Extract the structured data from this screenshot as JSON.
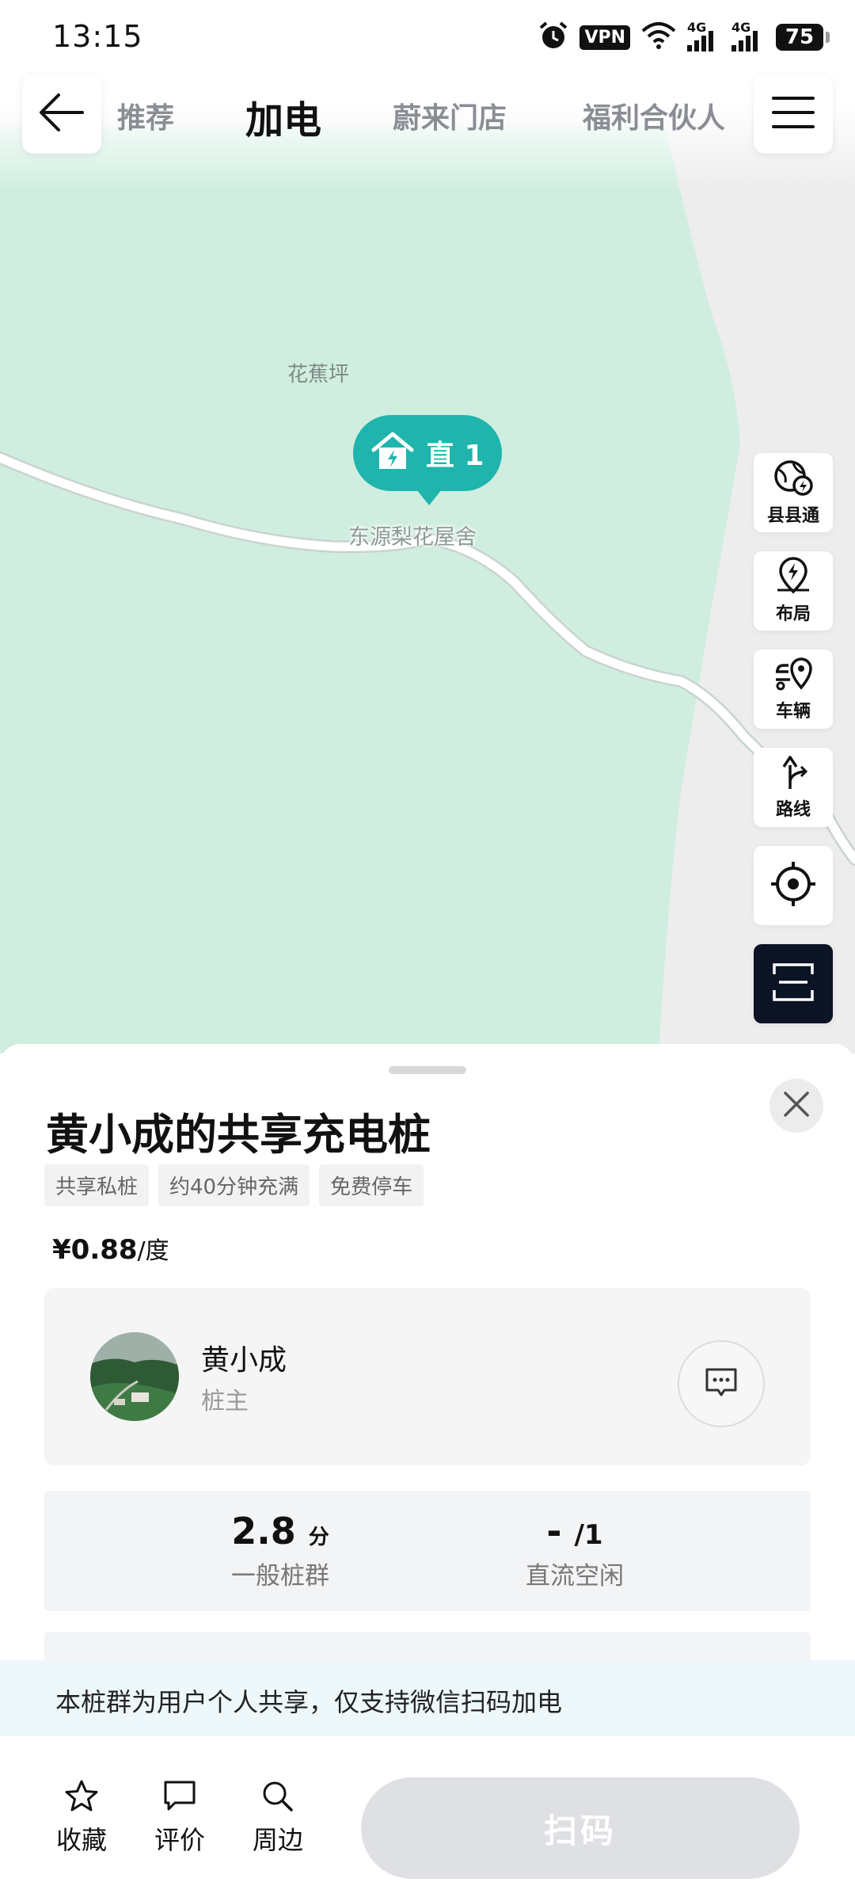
{
  "status_bar": {
    "time": "13:15",
    "vpn": "VPN",
    "net1": "4G",
    "net2": "4G",
    "battery": "75"
  },
  "nav": {
    "tabs": [
      {
        "label": "推荐"
      },
      {
        "label": "加电"
      },
      {
        "label": "蔚来门店"
      },
      {
        "label": "福利合伙人"
      }
    ],
    "active_tab": "加电"
  },
  "map": {
    "place_label": "花蕉坪",
    "marker_text": "直 1",
    "poi_label": "东源梨花屋舍",
    "colors": {
      "green_area": "#d0eee0",
      "background": "#ededed",
      "road": "#ffffff",
      "marker": "#1fb5ad"
    }
  },
  "tools": [
    {
      "label": "县县通",
      "icon": "county-globe-icon"
    },
    {
      "label": "布局",
      "icon": "layout-pin-icon"
    },
    {
      "label": "车辆",
      "icon": "vehicle-pin-icon"
    },
    {
      "label": "路线",
      "icon": "route-icon"
    },
    {
      "label": "",
      "icon": "locate-icon"
    },
    {
      "label": "",
      "icon": "scan-frame-icon"
    }
  ],
  "station": {
    "title": "黄小成的共享充电桩",
    "tags": [
      "共享私桩",
      "约40分钟充满",
      "免费停车"
    ],
    "price": "¥0.88",
    "price_unit": "/度"
  },
  "owner": {
    "name": "黄小成",
    "role": "桩主"
  },
  "stats": [
    {
      "value": "2.8",
      "unit": "分",
      "label": "一般桩群"
    },
    {
      "value": "-",
      "unit": "/1",
      "label": "直流空闲"
    }
  ],
  "notice": "本桩群为用户个人共享，仅支持微信扫码加电",
  "actions": [
    {
      "label": "收藏",
      "icon": "star-icon"
    },
    {
      "label": "评价",
      "icon": "comment-icon"
    },
    {
      "label": "周边",
      "icon": "search-icon"
    }
  ],
  "scan_button": "扫码"
}
